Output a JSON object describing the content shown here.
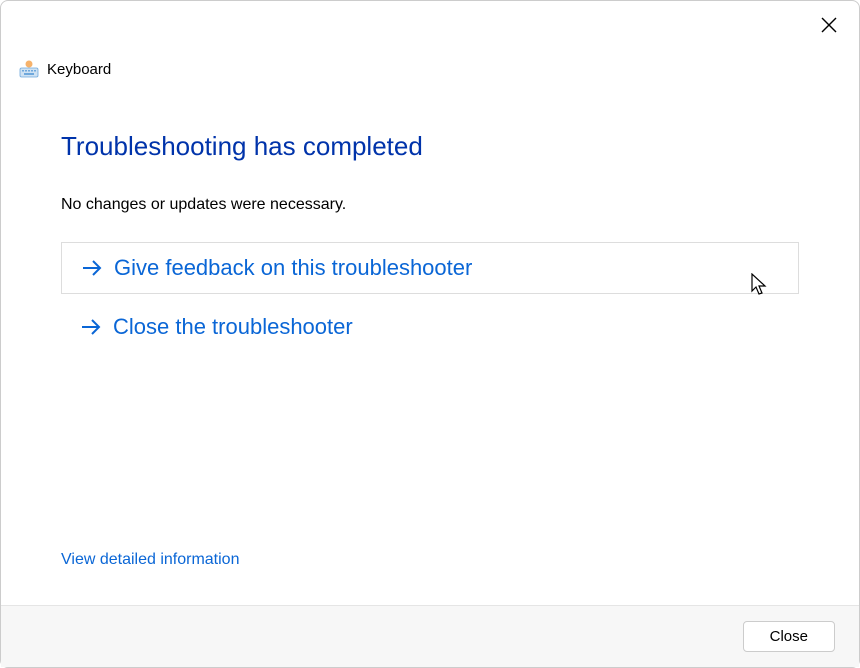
{
  "header": {
    "title": "Keyboard"
  },
  "main": {
    "heading": "Troubleshooting has completed",
    "subtext": "No changes or updates were necessary.",
    "actions": {
      "feedback": "Give feedback on this troubleshooter",
      "close": "Close the troubleshooter"
    },
    "detail_link": "View detailed information"
  },
  "footer": {
    "close_label": "Close"
  },
  "colors": {
    "link": "#0a66d6",
    "heading": "#0033aa"
  }
}
